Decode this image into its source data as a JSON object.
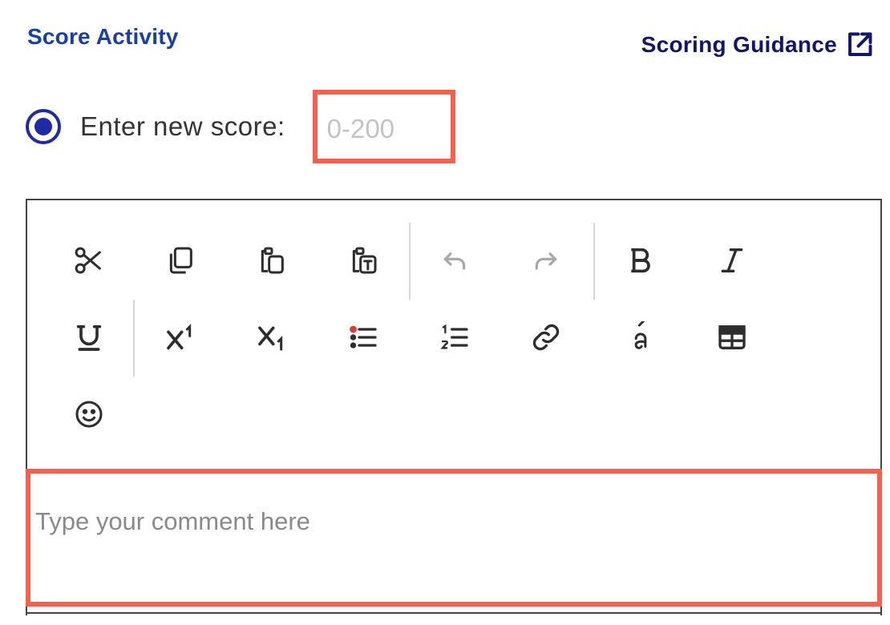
{
  "header": {
    "title": "Score Activity",
    "guidance_link": "Scoring Guidance"
  },
  "score": {
    "label": "Enter new score:",
    "placeholder": "0-200",
    "selected": true
  },
  "toolbar": {
    "rows": [
      [
        "scissors-icon",
        "copy-icon",
        "paste-icon",
        "paste-text-icon",
        "undo-icon",
        "redo-icon",
        "bold-icon",
        "italic-icon"
      ],
      [
        "underline-icon",
        "superscript-icon",
        "subscript-icon",
        "bulleted-list-icon",
        "numbered-list-icon",
        "link-icon",
        "special-character-icon",
        "table-icon"
      ],
      [
        "emoji-icon"
      ]
    ],
    "disabled": [
      "undo-icon",
      "redo-icon"
    ]
  },
  "comment": {
    "placeholder": "Type your comment here"
  },
  "colors": {
    "title": "#1a3fa3",
    "guidance": "#12166b",
    "radio": "#1f2aa6",
    "highlight": "#f5604f"
  }
}
